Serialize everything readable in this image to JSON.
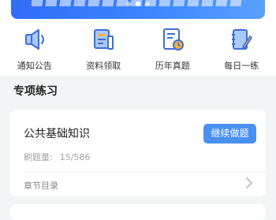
{
  "banner": {
    "slide_count": 3,
    "active_slide": 2
  },
  "quick_actions": [
    {
      "label": "通知公告",
      "icon": "speaker-icon"
    },
    {
      "label": "资料领取",
      "icon": "document-book-icon"
    },
    {
      "label": "历年真题",
      "icon": "exam-history-icon"
    },
    {
      "label": "每日一练",
      "icon": "notebook-pen-icon"
    }
  ],
  "section": {
    "title": "专项练习"
  },
  "practice_card": {
    "title": "公共基础知识",
    "button_label": "继续做题",
    "count_label": "刷题量:",
    "count_value": "15/586",
    "chapter_label": "章节目录"
  },
  "colors": {
    "accent": "#4a90f3",
    "icon_dark": "#3b6fd6",
    "icon_light": "#a9c8fb",
    "icon_yellow": "#f5b63a"
  }
}
